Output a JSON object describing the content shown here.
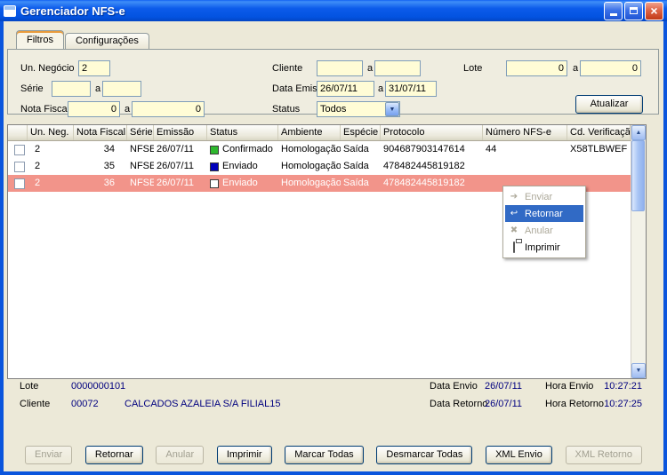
{
  "window": {
    "title": "Gerenciador NFS-e"
  },
  "tabs": {
    "filtros": "Filtros",
    "configuracoes": "Configurações"
  },
  "filters": {
    "labels": {
      "un_negocio": "Un. Negócio",
      "serie": "Série",
      "nota_fiscal": "Nota Fiscal",
      "cliente": "Cliente",
      "data_emissao": "Data Emissão",
      "status": "Status",
      "lote": "Lote",
      "range_separator": "a"
    },
    "values": {
      "un_negocio": "2",
      "serie_from": "",
      "serie_to": "",
      "nota_fiscal_from": "0",
      "nota_fiscal_to": "0",
      "cliente_from": "",
      "cliente_to": "",
      "data_emissao_from": "26/07/11",
      "data_emissao_to": "31/07/11",
      "status": "Todos",
      "lote_from": "0",
      "lote_to": "0"
    },
    "atualizar_button": "Atualizar"
  },
  "grid": {
    "headers": [
      "Un. Neg.",
      "Nota Fiscal",
      "Série",
      "Emissão",
      "Status",
      "Ambiente",
      "Espécie",
      "Protocolo",
      "Número NFS-e",
      "Cd. Verificação"
    ],
    "selected_row_color": "#f2948a",
    "rows": [
      {
        "un_neg": "2",
        "nota_fiscal": "34",
        "serie": "NFSE",
        "emissao": "26/07/11",
        "status": "Confirmado",
        "status_color": "#2eb82e",
        "ambiente": "Homologação",
        "especie": "Saída",
        "protocolo": "904687903147614",
        "numero_nfse": "44",
        "cd_verificacao": "X58TLBWEF"
      },
      {
        "un_neg": "2",
        "nota_fiscal": "35",
        "serie": "NFSE",
        "emissao": "26/07/11",
        "status": "Enviado",
        "status_color": "#0000bb",
        "ambiente": "Homologação",
        "especie": "Saída",
        "protocolo": "478482445819182",
        "numero_nfse": "",
        "cd_verificacao": ""
      },
      {
        "un_neg": "2",
        "nota_fiscal": "36",
        "serie": "NFSE",
        "emissao": "26/07/11",
        "status": "Enviado",
        "status_color": "#ffffff",
        "ambiente": "Homologação",
        "especie": "Saída",
        "protocolo": "478482445819182",
        "numero_nfse": "",
        "cd_verificacao": ""
      }
    ]
  },
  "context_menu": {
    "highlight_color": "#316ac5",
    "items": [
      {
        "label": "Enviar",
        "enabled": false
      },
      {
        "label": "Retornar",
        "enabled": true
      },
      {
        "label": "Anular",
        "enabled": false
      },
      {
        "label": "Imprimir",
        "enabled": true
      }
    ]
  },
  "footer": {
    "lote_label": "Lote",
    "lote_value": "0000000101",
    "cliente_label": "Cliente",
    "cliente_code": "00072",
    "cliente_name": "CALCADOS AZALEIA S/A FILIAL15",
    "data_envio_label": "Data Envio",
    "data_envio_value": "26/07/11",
    "hora_envio_label": "Hora Envio",
    "hora_envio_value": "10:27:21",
    "data_retorno_label": "Data Retorno",
    "data_retorno_value": "26/07/11",
    "hora_retorno_label": "Hora Retorno",
    "hora_retorno_value": "10:27:25"
  },
  "buttons": [
    {
      "label": "Enviar",
      "enabled": false
    },
    {
      "label": "Retornar",
      "enabled": true
    },
    {
      "label": "Anular",
      "enabled": false
    },
    {
      "label": "Imprimir",
      "enabled": true
    },
    {
      "label": "Marcar Todas",
      "enabled": true
    },
    {
      "label": "Desmarcar Todas",
      "enabled": true
    },
    {
      "label": "XML Envio",
      "enabled": true
    },
    {
      "label": "XML Retorno",
      "enabled": false
    }
  ]
}
